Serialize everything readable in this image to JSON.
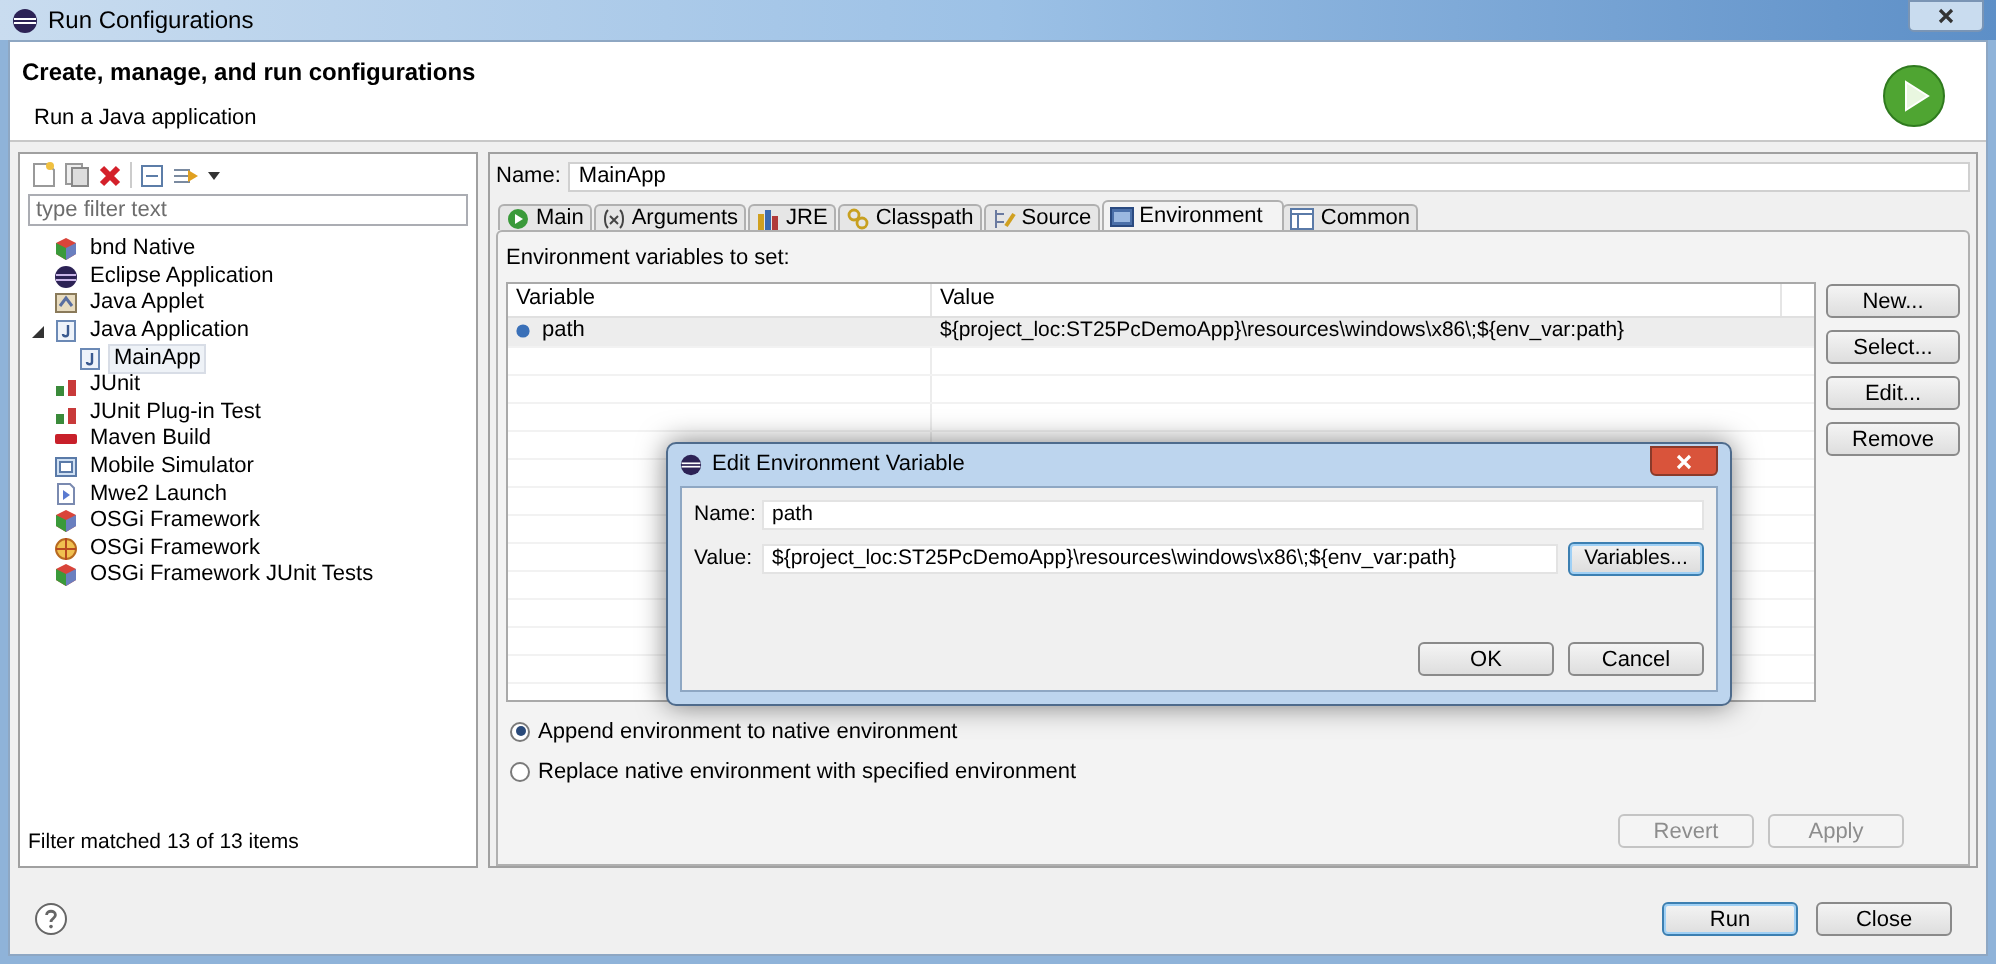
{
  "window": {
    "title": "Run Configurations"
  },
  "header": {
    "title": "Create, manage, and run configurations",
    "subtitle": "Run a Java application"
  },
  "filter": {
    "placeholder": "type filter text"
  },
  "tree": [
    {
      "label": "bnd Native",
      "kind": "bnd",
      "selected": false
    },
    {
      "label": "Eclipse Application",
      "kind": "eclipse",
      "selected": false
    },
    {
      "label": "Java Applet",
      "kind": "applet",
      "selected": false
    },
    {
      "label": "Java Application",
      "kind": "java",
      "selected": false,
      "expanded": true,
      "children": [
        {
          "label": "MainApp",
          "kind": "java",
          "selected": true
        }
      ]
    },
    {
      "label": "JUnit",
      "kind": "junit",
      "selected": false
    },
    {
      "label": "JUnit Plug-in Test",
      "kind": "junit",
      "selected": false
    },
    {
      "label": "Maven Build",
      "kind": "maven",
      "selected": false
    },
    {
      "label": "Mobile Simulator",
      "kind": "mobile",
      "selected": false
    },
    {
      "label": "Mwe2 Launch",
      "kind": "mwe",
      "selected": false
    },
    {
      "label": "OSGi Framework",
      "kind": "bnd",
      "selected": false
    },
    {
      "label": "OSGi Framework",
      "kind": "osgi",
      "selected": false
    },
    {
      "label": "OSGi Framework JUnit Tests",
      "kind": "bnd",
      "selected": false
    }
  ],
  "filter_status": "Filter matched 13 of 13 items",
  "name_field": {
    "label": "Name:",
    "value": "MainApp"
  },
  "tabs": [
    {
      "label": "Main",
      "kind": "main",
      "selected": false
    },
    {
      "label": "Arguments",
      "kind": "args",
      "selected": false
    },
    {
      "label": "JRE",
      "kind": "jre",
      "selected": false
    },
    {
      "label": "Classpath",
      "kind": "classpath",
      "selected": false
    },
    {
      "label": "Source",
      "kind": "source",
      "selected": false
    },
    {
      "label": "Environment",
      "kind": "env",
      "selected": true
    },
    {
      "label": "Common",
      "kind": "common",
      "selected": false
    }
  ],
  "env_label": "Environment variables to set:",
  "table": {
    "columns": [
      "Variable",
      "Value"
    ],
    "rows": [
      {
        "variable": "path",
        "value": "${project_loc:ST25PcDemoApp}\\resources\\windows\\x86\\;${env_var:path}",
        "selected": true
      }
    ]
  },
  "side_buttons": [
    "New...",
    "Select...",
    "Edit...",
    "Remove"
  ],
  "radios": [
    {
      "label": "Append environment to native environment",
      "selected": true
    },
    {
      "label": "Replace native environment with specified environment",
      "selected": false
    }
  ],
  "footer_buttons": [
    {
      "label": "Revert",
      "disabled": true
    },
    {
      "label": "Apply",
      "disabled": true
    }
  ],
  "bottom_buttons": [
    {
      "label": "Run",
      "default": true
    },
    {
      "label": "Close",
      "default": false
    }
  ],
  "dialog": {
    "title": "Edit Environment Variable",
    "name_label": "Name:",
    "name_value": "path",
    "value_label": "Value:",
    "value_value": "${project_loc:ST25PcDemoApp}\\resources\\windows\\x86\\;${env_var:path}",
    "variables_button": {
      "label": "Variables...",
      "focused": true
    },
    "buttons": [
      {
        "label": "OK"
      },
      {
        "label": "Cancel"
      }
    ]
  }
}
